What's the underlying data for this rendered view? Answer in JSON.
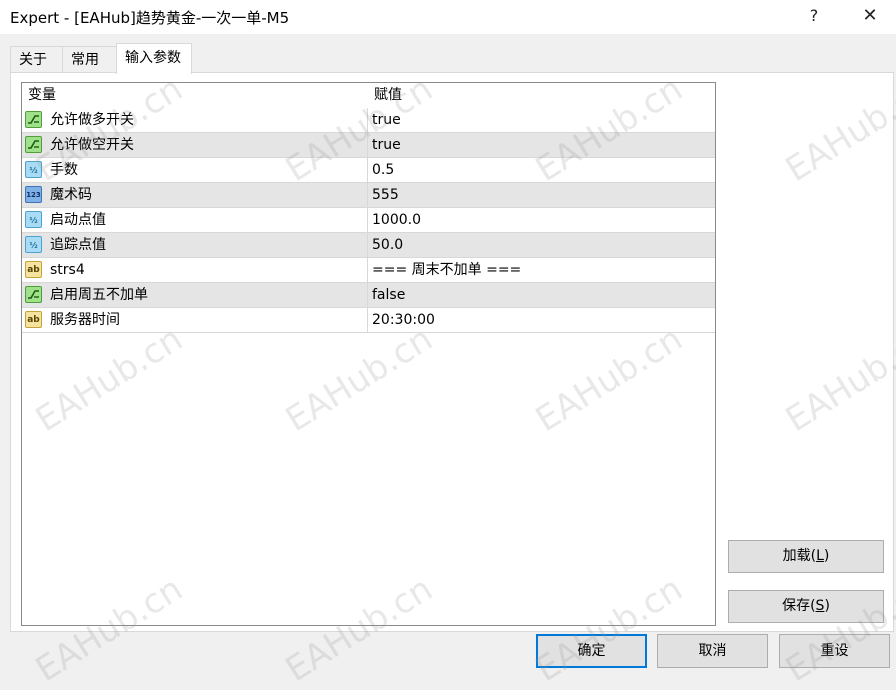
{
  "window": {
    "title": "Expert - [EAHub]趋势黄金-一次一单-M5",
    "help_label": "?",
    "close_label": "✕"
  },
  "tabs": [
    {
      "label": "关于"
    },
    {
      "label": "常用"
    },
    {
      "label": "输入参数",
      "active": true
    }
  ],
  "grid": {
    "col_variable": "变量",
    "col_value": "赋值",
    "rows": [
      {
        "icon": "toggle-icon",
        "name": "允许做多开关",
        "value": "true"
      },
      {
        "icon": "toggle-icon",
        "name": "允许做空开关",
        "value": "true"
      },
      {
        "icon": "double-icon",
        "name": "手数",
        "value": "0.5"
      },
      {
        "icon": "integer-icon",
        "name": "魔术码",
        "value": "555"
      },
      {
        "icon": "double-icon",
        "name": "启动点值",
        "value": "1000.0"
      },
      {
        "icon": "double-icon",
        "name": "追踪点值",
        "value": "50.0"
      },
      {
        "icon": "string-icon",
        "name": "strs4",
        "value": "=== 周末不加单 ==="
      },
      {
        "icon": "toggle-icon",
        "name": "启用周五不加单",
        "value": "false"
      },
      {
        "icon": "string-icon",
        "name": "服务器时间",
        "value": "20:30:00"
      }
    ]
  },
  "icon_glyphs": {
    "double": "½",
    "integer": "123",
    "string": "ab"
  },
  "buttons": {
    "load": {
      "text": "加载(",
      "key": "L",
      "close": ")"
    },
    "save": {
      "text": "保存(",
      "key": "S",
      "close": ")"
    },
    "ok": "确定",
    "cancel": "取消",
    "reset": "重设"
  },
  "watermark": "EAHub.cn"
}
